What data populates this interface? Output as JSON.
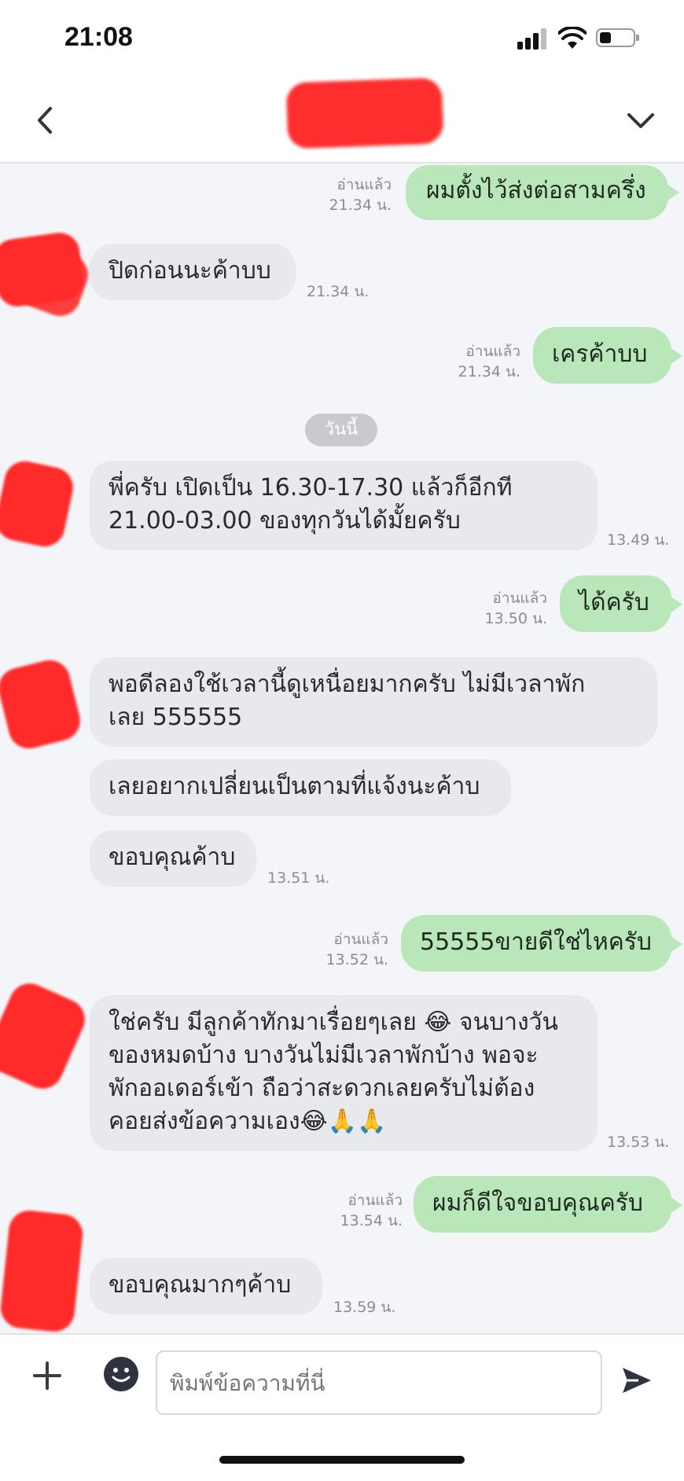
{
  "status_bar": {
    "time": "21:08"
  },
  "header": {
    "contact_name": ""
  },
  "messages": [
    {
      "side": "out",
      "text": "ผมตั้งไว้ส่งต่อสามครึ่ง",
      "read": "อ่านแล้ว",
      "time": "21.34 น."
    },
    {
      "side": "in",
      "text": "ปิดก่อนนะค้าบบ",
      "time": "21.34 น."
    },
    {
      "side": "out",
      "text": "เครค้าบบ",
      "read": "อ่านแล้ว",
      "time": "21.34 น."
    },
    {
      "side": "in",
      "text": "พี่ครับ เปิดเป็น 16.30-17.30 แล้วก็อีกที\n21.00-03.00 ของทุกวันได้มั้ยครับ",
      "time": "13.49 น."
    },
    {
      "side": "out",
      "text": "ได้ครับ",
      "read": "อ่านแล้ว",
      "time": "13.50 น."
    },
    {
      "side": "in",
      "text": "พอดีลองใช้เวลานี้ดูเหนื่อยมากครับ ไม่มีเวลาพัก\nเลย 555555"
    },
    {
      "side": "in",
      "text": "เลยอยากเปลี่ยนเป็นตามที่แจ้งนะค้าบ"
    },
    {
      "side": "in",
      "text": "ขอบคุณค้าบ",
      "time": "13.51 น."
    },
    {
      "side": "out",
      "text": "55555ขายดีใช่ไหครับ",
      "read": "อ่านแล้ว",
      "time": "13.52 น."
    },
    {
      "side": "in",
      "text": "ใช่ครับ มีลูกค้าทักมาเรื่อยๆเลย 😂 จนบางวัน\nของหมดบ้าง บางวันไม่มีเวลาพักบ้าง พอจะ\nพักออเดอร์เข้า ถือว่าสะดวกเลยครับไม่ต้อง\nคอยส่งข้อความเอง😂🙏🙏",
      "time": "13.53 น."
    },
    {
      "side": "out",
      "text": "ผมก็ดีใจขอบคุณครับ",
      "read": "อ่านแล้ว",
      "time": "13.54 น."
    },
    {
      "side": "in",
      "text": "ขอบคุณมากๆค้าบ",
      "time": "13.59 น."
    }
  ],
  "date_divider": "วันนี้",
  "input": {
    "placeholder": "พิมพ์ข้อความที่นี่"
  },
  "colors": {
    "outgoing_bubble": "#b9e7ba",
    "incoming_bubble": "#e8e9ed",
    "send_icon": "#2f3340"
  },
  "icons": [
    "back-icon",
    "chevron-down-icon",
    "plus-icon",
    "sticker-icon",
    "send-icon",
    "signal-icon",
    "wifi-icon",
    "battery-icon"
  ]
}
